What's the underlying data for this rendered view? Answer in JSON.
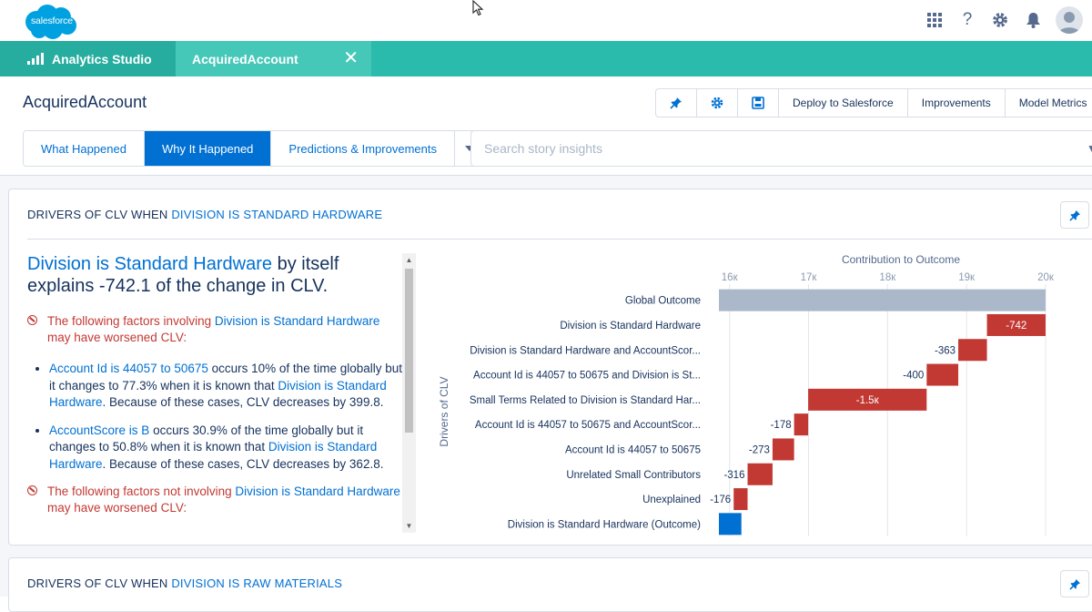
{
  "brand": {
    "logo_text": "salesforce"
  },
  "header_icons": [
    "app-launcher-icon",
    "help-icon",
    "setup-gear-icon",
    "notifications-bell-icon"
  ],
  "tabs": {
    "app_name": "Analytics Studio",
    "active_tab": "AcquiredAccount"
  },
  "page": {
    "title": "AcquiredAccount",
    "actions": [
      "Deploy to Salesforce",
      "Improvements",
      "Model Metrics"
    ]
  },
  "story_tabs": [
    "What Happened",
    "Why It Happened",
    "Predictions & Improvements"
  ],
  "search": {
    "placeholder": "Search story insights"
  },
  "card1": {
    "title_prefix": "DRIVERS OF CLV WHEN ",
    "title_highlight": "DIVISION IS STANDARD HARDWARE",
    "headline_hl": "Division is Standard Hardware",
    "headline_rest": " by itself explains -742.1 of the change in CLV.",
    "factor1": {
      "pre": "The following factors involving ",
      "hl": "Division is Standard Hardware",
      "post": " may have worsened CLV:"
    },
    "bullets": [
      {
        "hl1": "Account Id is 44057 to 50675",
        "t1": " occurs 10% of the time globally but it changes to 77.3% when it is known that ",
        "hl2": "Division is Standard Hardware",
        "t2": ". Because of these cases, CLV decreases by 399.8."
      },
      {
        "hl1": "AccountScore is B",
        "t1": " occurs 30.9% of the time globally but it changes to 50.8% when it is known that ",
        "hl2": "Division is Standard Hardware",
        "t2": ". Because of these cases, CLV decreases by 362.8."
      }
    ],
    "factor2": {
      "pre": "The following factors not involving ",
      "hl": "Division is Standard Hardware",
      "post": " may have worsened CLV:"
    }
  },
  "card2": {
    "title_prefix": "DRIVERS OF CLV WHEN ",
    "title_highlight": "DIVISION IS RAW MATERIALS"
  },
  "chart_data": {
    "type": "bar",
    "subtype": "waterfall",
    "title": "Contribution to Outcome",
    "ylabel": "Drivers of CLV",
    "x_ticks": [
      "16к",
      "17к",
      "18к",
      "19к",
      "20к"
    ],
    "x_tick_values": [
      16000,
      17000,
      18000,
      19000,
      20000
    ],
    "xlim": [
      15750,
      20150
    ],
    "grid": true,
    "colors": {
      "baseline": "#aab8c9",
      "negative": "#c23934",
      "outcome": "#0070d2"
    },
    "categories": [
      "Global Outcome",
      "Division is Standard Hardware",
      "Division is Standard Hardware and AccountScor...",
      "Account Id is 44057 to 50675 and Division is St...",
      "Small Terms Related to Division is Standard Har...",
      "Account Id is 44057 to 50675 and AccountScor...",
      "Account Id is 44057 to 50675",
      "Unrelated Small Contributors",
      "Unexplained",
      "Division is Standard Hardware (Outcome)"
    ],
    "values": [
      20000,
      -742,
      -363,
      -400,
      -1500,
      -178,
      -273,
      -316,
      -176,
      16150
    ],
    "labels": [
      "",
      "-742",
      "-363",
      "-400",
      "-1.5к",
      "-178",
      "-273",
      "-316",
      "-176",
      ""
    ],
    "kinds": [
      "baseline",
      "negative",
      "negative",
      "negative",
      "negative",
      "negative",
      "negative",
      "negative",
      "negative",
      "outcome"
    ]
  }
}
